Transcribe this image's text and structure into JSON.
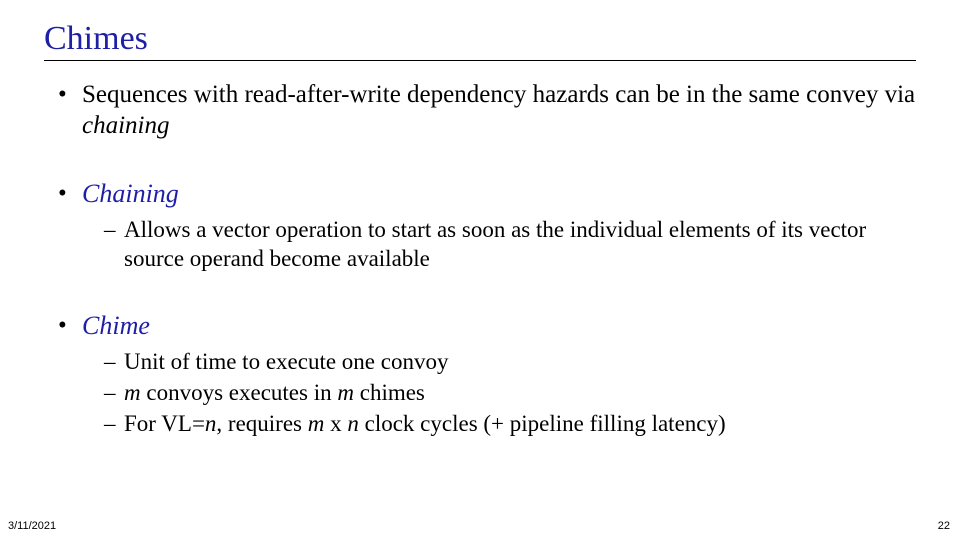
{
  "title": "Chimes",
  "bullets": {
    "b1_prefix": "Sequences with read-after-write dependency hazards can be in the same convey via ",
    "b1_italic": "chaining",
    "b2_heading": "Chaining",
    "b2_sub1": "Allows a vector operation to start as soon as the individual elements of its vector source operand become available",
    "b3_heading": "Chime",
    "b3_sub1": "Unit of time to execute one convoy",
    "b3_sub2_m1": "m",
    "b3_sub2_mid": " convoys executes in ",
    "b3_sub2_m2": "m",
    "b3_sub2_end": " chimes",
    "b3_sub3_pre": "For VL=",
    "b3_sub3_n": "n",
    "b3_sub3_mid": ", requires ",
    "b3_sub3_m": "m",
    "b3_sub3_x": " x ",
    "b3_sub3_n2": "n",
    "b3_sub3_end": " clock cycles (+ pipeline filling latency)"
  },
  "footer": {
    "date": "3/11/2021",
    "page": "22"
  }
}
